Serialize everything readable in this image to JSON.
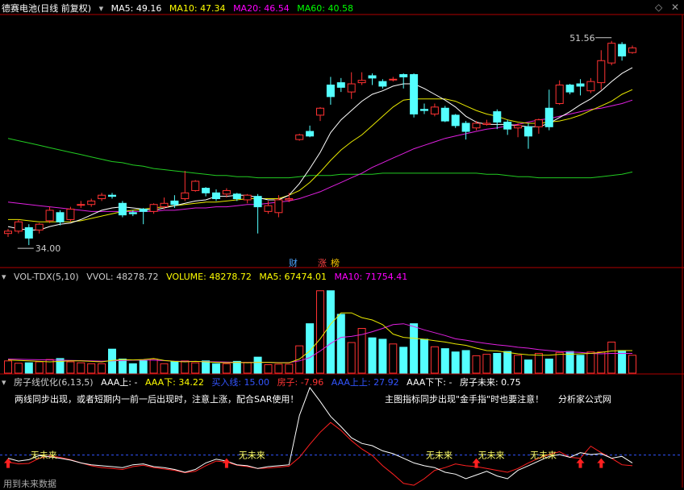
{
  "chart_data": [
    {
      "type": "candlestick",
      "title": "德赛电池(日线 前复权)",
      "ma_legend": [
        {
          "name": "MA5",
          "value": "49.16",
          "color": "#ffffff"
        },
        {
          "name": "MA10",
          "value": "47.34",
          "color": "#ffff00"
        },
        {
          "name": "MA20",
          "value": "46.54",
          "color": "#ff00ff"
        },
        {
          "name": "MA60",
          "value": "40.58",
          "color": "#00ff00"
        }
      ],
      "ylim": [
        32.2,
        53.6
      ],
      "high_label": "51.56",
      "low_label": "34.00",
      "event_badges": [
        {
          "text": "财",
          "color": "#4da6ff"
        },
        {
          "text": "涨",
          "color": "#ff4444"
        },
        {
          "text": "榜",
          "color": "#ffcc00"
        }
      ],
      "candles": [
        [
          35.0,
          35.2,
          34.7,
          35.4
        ],
        [
          35.2,
          36.0,
          35.0,
          36.2
        ],
        [
          35.5,
          34.6,
          34.0,
          35.8
        ],
        [
          35.3,
          35.8,
          35.0,
          35.9
        ],
        [
          36.1,
          37.0,
          35.9,
          37.3
        ],
        [
          36.8,
          36.0,
          35.7,
          37.0
        ],
        [
          36.2,
          37.1,
          36.0,
          37.3
        ],
        [
          37.5,
          37.5,
          37.2,
          37.8
        ],
        [
          37.5,
          37.8,
          37.3,
          38.0
        ],
        [
          38.0,
          38.3,
          37.8,
          38.5
        ],
        [
          38.3,
          38.2,
          38.0,
          38.5
        ],
        [
          37.6,
          36.6,
          36.4,
          37.8
        ],
        [
          36.8,
          36.7,
          36.5,
          37.0
        ],
        [
          37.1,
          36.9,
          35.8,
          37.2
        ],
        [
          36.9,
          37.5,
          36.7,
          37.6
        ],
        [
          37.3,
          37.6,
          37.1,
          38.1
        ],
        [
          37.8,
          37.5,
          37.2,
          38.3
        ],
        [
          38.0,
          38.5,
          37.8,
          40.4
        ],
        [
          38.7,
          39.5,
          38.6,
          39.6
        ],
        [
          38.9,
          38.5,
          38.2,
          39.0
        ],
        [
          38.5,
          38.0,
          37.8,
          38.8
        ],
        [
          38.4,
          38.7,
          38.1,
          38.9
        ],
        [
          38.4,
          38.0,
          37.8,
          38.5
        ],
        [
          37.9,
          38.3,
          37.6,
          38.4
        ],
        [
          38.2,
          37.3,
          35.0,
          38.4
        ],
        [
          36.9,
          37.4,
          36.7,
          37.8
        ],
        [
          36.8,
          37.9,
          36.4,
          38.3
        ],
        [
          37.9,
          38.0,
          37.7,
          38.5
        ],
        [
          43.1,
          43.5,
          43.0,
          43.6
        ],
        [
          43.8,
          43.4,
          43.3,
          44.3
        ],
        [
          45.2,
          45.8,
          44.7,
          45.9
        ],
        [
          47.8,
          46.8,
          46.1,
          48.5
        ],
        [
          48.0,
          47.6,
          47.2,
          48.4
        ],
        [
          47.2,
          47.9,
          46.6,
          48.9
        ],
        [
          48.0,
          48.2,
          47.8,
          48.9
        ],
        [
          48.6,
          48.4,
          47.8,
          48.8
        ],
        [
          48.1,
          47.7,
          47.5,
          48.3
        ],
        [
          48.3,
          48.3,
          48.1,
          48.5
        ],
        [
          48.7,
          48.5,
          47.5,
          48.8
        ],
        [
          48.7,
          45.3,
          45.0,
          48.8
        ],
        [
          45.7,
          45.6,
          45.3,
          46.2
        ],
        [
          45.3,
          45.9,
          45.1,
          46.2
        ],
        [
          45.8,
          44.7,
          44.6,
          46.0
        ],
        [
          45.2,
          44.3,
          44.1,
          45.3
        ],
        [
          44.5,
          43.8,
          43.1,
          44.7
        ],
        [
          44.1,
          44.5,
          43.9,
          44.7
        ],
        [
          44.4,
          44.5,
          44.3,
          44.8
        ],
        [
          45.5,
          44.6,
          44.0,
          45.7
        ],
        [
          44.6,
          44.0,
          43.5,
          44.8
        ],
        [
          44.1,
          44.3,
          43.3,
          44.5
        ],
        [
          44.2,
          43.4,
          42.3,
          44.5
        ],
        [
          44.2,
          44.8,
          43.6,
          44.9
        ],
        [
          45.8,
          44.2,
          43.9,
          47.4
        ],
        [
          46.2,
          47.8,
          46.1,
          48.2
        ],
        [
          47.8,
          47.2,
          47.0,
          47.9
        ],
        [
          47.9,
          47.7,
          46.9,
          48.3
        ],
        [
          47.3,
          48.1,
          47.1,
          48.4
        ],
        [
          48.0,
          49.9,
          47.4,
          50.8
        ],
        [
          49.7,
          51.4,
          49.5,
          51.6
        ],
        [
          51.3,
          50.3,
          49.9,
          51.5
        ],
        [
          50.6,
          51.0,
          50.5,
          51.2
        ]
      ],
      "ma5": [
        35.6,
        35.4,
        35.3,
        35.3,
        35.6,
        35.8,
        35.9,
        36.2,
        36.6,
        37.0,
        37.2,
        37.3,
        37.2,
        37.1,
        37.0,
        37.2,
        37.4,
        37.6,
        37.8,
        37.9,
        38.2,
        38.2,
        38.3,
        38.3,
        38.1,
        37.9,
        37.9,
        38.3,
        39.3,
        40.6,
        42.0,
        43.7,
        44.8,
        45.6,
        46.4,
        47.0,
        47.3,
        47.7,
        47.9,
        47.9,
        47.5,
        47.0,
        46.5,
        45.9,
        45.1,
        44.6,
        44.4,
        44.4,
        44.4,
        44.3,
        44.2,
        44.2,
        44.5,
        45.0,
        45.5,
        46.1,
        46.6,
        47.3,
        48.1,
        48.8,
        49.3
      ],
      "ma10": [
        36.2,
        36.2,
        36.1,
        36.0,
        36.0,
        36.0,
        36.0,
        36.1,
        36.3,
        36.5,
        36.7,
        36.9,
        37.0,
        37.1,
        37.2,
        37.3,
        37.4,
        37.5,
        37.6,
        37.7,
        37.7,
        37.8,
        37.9,
        38.0,
        38.0,
        38.0,
        38.0,
        38.3,
        38.7,
        39.4,
        40.3,
        41.3,
        42.2,
        42.9,
        43.5,
        44.3,
        45.1,
        45.9,
        46.5,
        46.6,
        46.6,
        46.6,
        46.6,
        46.4,
        46.0,
        45.6,
        45.3,
        45.1,
        44.8,
        44.6,
        44.5,
        44.5,
        44.6,
        44.7,
        44.9,
        45.2,
        45.6,
        46.0,
        46.4,
        47.0,
        47.4
      ],
      "ma20": [
        37.7,
        37.6,
        37.5,
        37.4,
        37.3,
        37.2,
        37.1,
        37.0,
        36.9,
        36.9,
        36.9,
        36.9,
        36.9,
        36.9,
        36.9,
        37.0,
        37.0,
        37.1,
        37.2,
        37.2,
        37.3,
        37.3,
        37.4,
        37.5,
        37.5,
        37.6,
        37.7,
        37.8,
        38.0,
        38.3,
        38.6,
        39.0,
        39.4,
        39.8,
        40.2,
        40.7,
        41.1,
        41.5,
        41.9,
        42.3,
        42.6,
        42.9,
        43.2,
        43.4,
        43.6,
        43.8,
        44.0,
        44.1,
        44.3,
        44.4,
        44.6,
        44.8,
        44.9,
        45.1,
        45.3,
        45.5,
        45.7,
        45.8,
        46.0,
        46.2,
        46.5
      ],
      "ma60": [
        43.2,
        43.0,
        42.8,
        42.6,
        42.4,
        42.2,
        42.0,
        41.8,
        41.6,
        41.4,
        41.2,
        41.1,
        40.9,
        40.8,
        40.6,
        40.5,
        40.4,
        40.3,
        40.2,
        40.1,
        40.0,
        40.0,
        39.9,
        39.9,
        39.8,
        39.8,
        39.8,
        39.8,
        39.9,
        40.0,
        40.0,
        40.0,
        40.1,
        40.1,
        40.1,
        40.1,
        40.2,
        40.2,
        40.2,
        40.2,
        40.2,
        40.2,
        40.2,
        40.2,
        40.2,
        40.2,
        40.1,
        40.1,
        40.0,
        39.9,
        39.9,
        39.8,
        39.8,
        39.8,
        39.8,
        39.8,
        39.8,
        39.9,
        40.0,
        40.1,
        40.3
      ]
    },
    {
      "type": "bar",
      "indicator": "VOL-TDX(5,10)",
      "legend": [
        {
          "text": "VVOL: 48278.72",
          "color": "#cccccc"
        },
        {
          "text": "VOLUME: 48278.72",
          "color": "#ffff00"
        },
        {
          "text": "MA5: 67474.01",
          "color": "#ffff00"
        },
        {
          "text": "MA10: 71754.41",
          "color": "#ff00ff"
        }
      ],
      "ylim": [
        0,
        190000
      ],
      "volume": [
        26000,
        21000,
        22000,
        24000,
        29000,
        31000,
        24000,
        22000,
        20000,
        20000,
        51000,
        30000,
        20000,
        27000,
        30000,
        20000,
        25000,
        26000,
        22000,
        26000,
        20000,
        20000,
        25000,
        23000,
        34000,
        18000,
        19000,
        19000,
        58000,
        105000,
        175000,
        175000,
        125000,
        65000,
        95000,
        75000,
        72000,
        62000,
        55000,
        105000,
        72000,
        56000,
        52000,
        45000,
        48000,
        37000,
        40000,
        42000,
        46000,
        38000,
        28000,
        42000,
        30000,
        44000,
        46000,
        38000,
        45000,
        45000,
        66000,
        48000,
        38000
      ],
      "ma5": [
        28000,
        27000,
        26000,
        25000,
        24000,
        25000,
        26000,
        26000,
        25000,
        24000,
        27000,
        29000,
        28000,
        29000,
        31000,
        27000,
        25000,
        24000,
        25000,
        24000,
        23000,
        22000,
        23000,
        22000,
        23000,
        23000,
        22000,
        22000,
        30000,
        47000,
        73000,
        104000,
        128000,
        128000,
        118000,
        113000,
        103000,
        83000,
        76000,
        74000,
        72000,
        69000,
        66000,
        62000,
        59000,
        53000,
        48000,
        47000,
        44000,
        41000,
        39000,
        38000,
        38000,
        40000,
        40000,
        41000,
        42000,
        44000,
        47000,
        48000,
        48000
      ],
      "ma10": [
        30000,
        29500,
        29000,
        28500,
        28000,
        27500,
        27000,
        26500,
        26000,
        25500,
        26000,
        27000,
        27500,
        27500,
        27500,
        26500,
        25500,
        25000,
        25000,
        24500,
        24000,
        23500,
        23000,
        22500,
        23000,
        23000,
        22500,
        22500,
        26000,
        33000,
        47000,
        63000,
        76000,
        78000,
        82000,
        88000,
        95000,
        103000,
        105000,
        99000,
        92000,
        86000,
        80000,
        73000,
        70000,
        66000,
        63000,
        60000,
        58000,
        55000,
        53000,
        50000,
        48000,
        46000,
        45000,
        44000,
        42000,
        41000,
        42000,
        42000,
        42000
      ]
    },
    {
      "type": "line",
      "indicator": "房子线优化(6,13,5)",
      "legend": [
        {
          "text": "AAA上: -",
          "color": "#ffffff"
        },
        {
          "text": "AAA下: 34.22",
          "color": "#ffff00"
        },
        {
          "text": "买入线: 15.00",
          "color": "#3355ff"
        },
        {
          "text": "房子: -7.96",
          "color": "#ff3333"
        },
        {
          "text": "AAA上上: 27.92",
          "color": "#3355ff"
        },
        {
          "text": "AAA下下: -",
          "color": "#ffffff"
        },
        {
          "text": "房子未来: 0.75",
          "color": "#ffffff"
        }
      ],
      "notes": [
        "两线同步出现，或者短期内一前一后出现时，注意上涨，配合SAR使用！",
        "主图指标同步出现\"金手指\"时也要注意！",
        "分析家公式网"
      ],
      "ylim": [
        -55,
        165
      ],
      "buy_line": 15,
      "white": [
        8,
        2,
        5,
        14,
        11,
        8,
        4,
        -2,
        -6,
        -8,
        -10,
        -12,
        -6,
        -4,
        -10,
        -12,
        -16,
        -22,
        -16,
        -2,
        6,
        2,
        -6,
        -8,
        -14,
        -10,
        -8,
        -6,
        100,
        160,
        130,
        98,
        76,
        52,
        40,
        35,
        24,
        18,
        8,
        -2,
        -8,
        -12,
        -22,
        -26,
        -36,
        -28,
        -20,
        -30,
        -36,
        -18,
        -8,
        2,
        12,
        16,
        10,
        20,
        16,
        18,
        8,
        12,
        -2
      ],
      "red": [
        0,
        -4,
        -3,
        8,
        13,
        10,
        5,
        -2,
        -8,
        -12,
        -14,
        -16,
        -10,
        -7,
        -12,
        -15,
        -18,
        -23,
        -20,
        -8,
        2,
        0,
        -7,
        -10,
        -14,
        -13,
        -11,
        -9,
        10,
        38,
        64,
        85,
        68,
        46,
        28,
        14,
        -8,
        -26,
        -46,
        -50,
        -36,
        -18,
        -12,
        -4,
        -8,
        -10,
        -14,
        -18,
        -22,
        -14,
        -2,
        8,
        16,
        22,
        10,
        8,
        34,
        20,
        8,
        -6,
        -8
      ],
      "arrows": [
        0,
        21,
        45,
        55,
        57
      ],
      "future_labels": [
        {
          "i": 2,
          "text": "无未来"
        },
        {
          "i": 22,
          "text": "无未来"
        },
        {
          "i": 40,
          "text": "无未来"
        },
        {
          "i": 45,
          "text": "无未来"
        },
        {
          "i": 50,
          "text": "无未来"
        }
      ]
    }
  ],
  "footer": "用到未来数据",
  "colors": {
    "up": "#ff3232",
    "down": "#54ffff",
    "separator": "#b00000"
  },
  "icons": [
    "triangle-down-icon",
    "diamond-icon",
    "close-icon"
  ]
}
